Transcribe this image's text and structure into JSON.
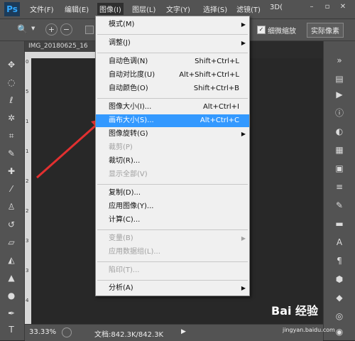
{
  "app": {
    "logo": "Ps"
  },
  "menubar": {
    "items": [
      "文件(F)",
      "编辑(E)",
      "图像(I)",
      "图层(L)",
      "文字(Y)",
      "选择(S)",
      "滤镜(T)",
      "3D("
    ]
  },
  "options_bar": {
    "checkbox_label": "细微缩放",
    "button_label": "实际像素"
  },
  "document": {
    "tab_title": "IMG_20180625_16"
  },
  "ruler": {
    "numbers": [
      "0",
      "5",
      "1",
      "1",
      "2",
      "2",
      "3",
      "3",
      "4"
    ]
  },
  "status": {
    "zoom": "33.33%",
    "doc_info": "文档:842.3K/842.3K"
  },
  "image_menu": {
    "items": [
      {
        "label": "模式(M)",
        "shortcut": "",
        "submenu": true,
        "disabled": false
      },
      {
        "label": "调整(J)",
        "shortcut": "",
        "submenu": true,
        "disabled": false
      },
      {
        "label": "自动色调(N)",
        "shortcut": "Shift+Ctrl+L",
        "submenu": false,
        "disabled": false
      },
      {
        "label": "自动对比度(U)",
        "shortcut": "Alt+Shift+Ctrl+L",
        "submenu": false,
        "disabled": false
      },
      {
        "label": "自动颜色(O)",
        "shortcut": "Shift+Ctrl+B",
        "submenu": false,
        "disabled": false
      },
      {
        "label": "图像大小(I)...",
        "shortcut": "Alt+Ctrl+I",
        "submenu": false,
        "disabled": false
      },
      {
        "label": "画布大小(S)...",
        "shortcut": "Alt+Ctrl+C",
        "submenu": false,
        "disabled": false,
        "highlighted": true
      },
      {
        "label": "图像旋转(G)",
        "shortcut": "",
        "submenu": true,
        "disabled": false
      },
      {
        "label": "裁剪(P)",
        "shortcut": "",
        "submenu": false,
        "disabled": true
      },
      {
        "label": "裁切(R)...",
        "shortcut": "",
        "submenu": false,
        "disabled": false
      },
      {
        "label": "显示全部(V)",
        "shortcut": "",
        "submenu": false,
        "disabled": true
      },
      {
        "label": "复制(D)...",
        "shortcut": "",
        "submenu": false,
        "disabled": false
      },
      {
        "label": "应用图像(Y)...",
        "shortcut": "",
        "submenu": false,
        "disabled": false
      },
      {
        "label": "计算(C)...",
        "shortcut": "",
        "submenu": false,
        "disabled": false
      },
      {
        "label": "变量(B)",
        "shortcut": "",
        "submenu": true,
        "disabled": true
      },
      {
        "label": "应用数据组(L)...",
        "shortcut": "",
        "submenu": false,
        "disabled": true
      },
      {
        "label": "陷印(T)...",
        "shortcut": "",
        "submenu": false,
        "disabled": true
      },
      {
        "label": "分析(A)",
        "shortcut": "",
        "submenu": true,
        "disabled": false
      }
    ]
  },
  "watermark": {
    "brand": "Bai 经验",
    "url": "jingyan.baidu.com"
  },
  "colors": {
    "accent": "#3399ff",
    "arrow": "#e23030",
    "ui_bg": "#535353",
    "canvas": "#282828"
  }
}
